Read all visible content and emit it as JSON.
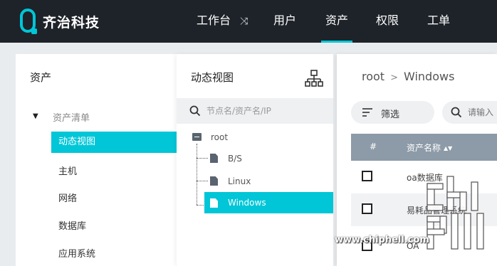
{
  "brand": {
    "name": "齐治科技"
  },
  "nav": {
    "items": [
      {
        "label": "工作台",
        "icon": "shuffle-icon"
      },
      {
        "label": "用户"
      },
      {
        "label": "资产"
      },
      {
        "label": "权限"
      },
      {
        "label": "工单"
      }
    ],
    "active": "资产"
  },
  "sidebar": {
    "title": "资产",
    "group_label": "资产清单",
    "items": [
      {
        "label": "动态视图",
        "active": true
      },
      {
        "label": "主机"
      },
      {
        "label": "网络"
      },
      {
        "label": "数据库"
      },
      {
        "label": "应用系统"
      }
    ]
  },
  "tree_panel": {
    "title": "动态视图",
    "search_placeholder": "节点名/资产名/IP",
    "root": "root",
    "children": [
      "B/S",
      "Linux",
      "Windows"
    ],
    "selected": "Windows"
  },
  "detail": {
    "breadcrumb": [
      "root",
      "Windows"
    ],
    "breadcrumb_sep": ">",
    "filter_label": "筛选",
    "search_placeholder": "请输入",
    "table": {
      "headers": [
        "#",
        "资产名称"
      ],
      "rows": [
        {
          "name": "oa数据库"
        },
        {
          "name": "易耗品管理系统"
        },
        {
          "name": "OA"
        }
      ]
    }
  },
  "watermark": {
    "text": "www.chiphell.com"
  },
  "colors": {
    "accent": "#00c6d7",
    "topbar": "#1e2329",
    "table_header": "#8d9aa7"
  }
}
